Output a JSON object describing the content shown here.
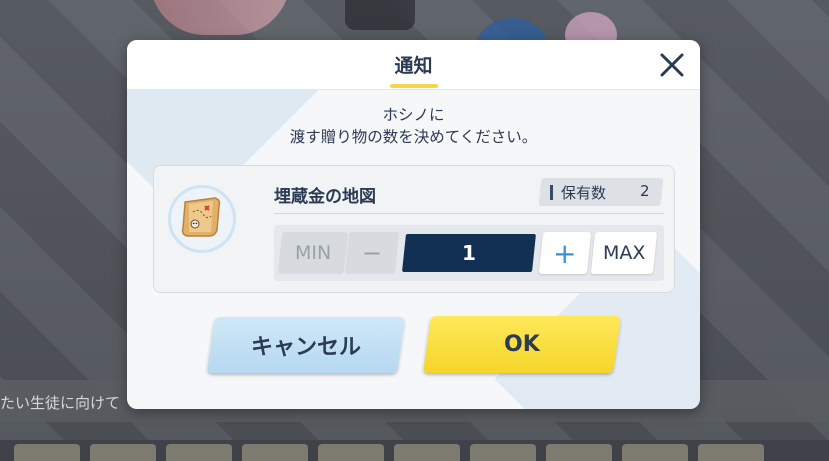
{
  "background": {
    "strip_text": "たい生徒に向けて"
  },
  "dialog": {
    "title": "通知",
    "message_line1": "ホシノに",
    "message_line2": "渡す贈り物の数を決めてください。",
    "item": {
      "name": "埋蔵金の地図",
      "icon": "treasure-map-icon",
      "owned_label": "保有数",
      "owned_count": "2"
    },
    "stepper": {
      "min_label": "MIN",
      "minus_label": "−",
      "quantity": "1",
      "plus_label": "+",
      "max_label": "MAX"
    },
    "cancel_label": "キャンセル",
    "ok_label": "OK"
  },
  "colors": {
    "title_text": "#2b3b54",
    "title_underline": "#f4d64a",
    "quantity_field": "#123054",
    "ok_button": "#f4d52a",
    "cancel_button": "#b6d8f0",
    "plus_icon": "#3c8fd6"
  }
}
